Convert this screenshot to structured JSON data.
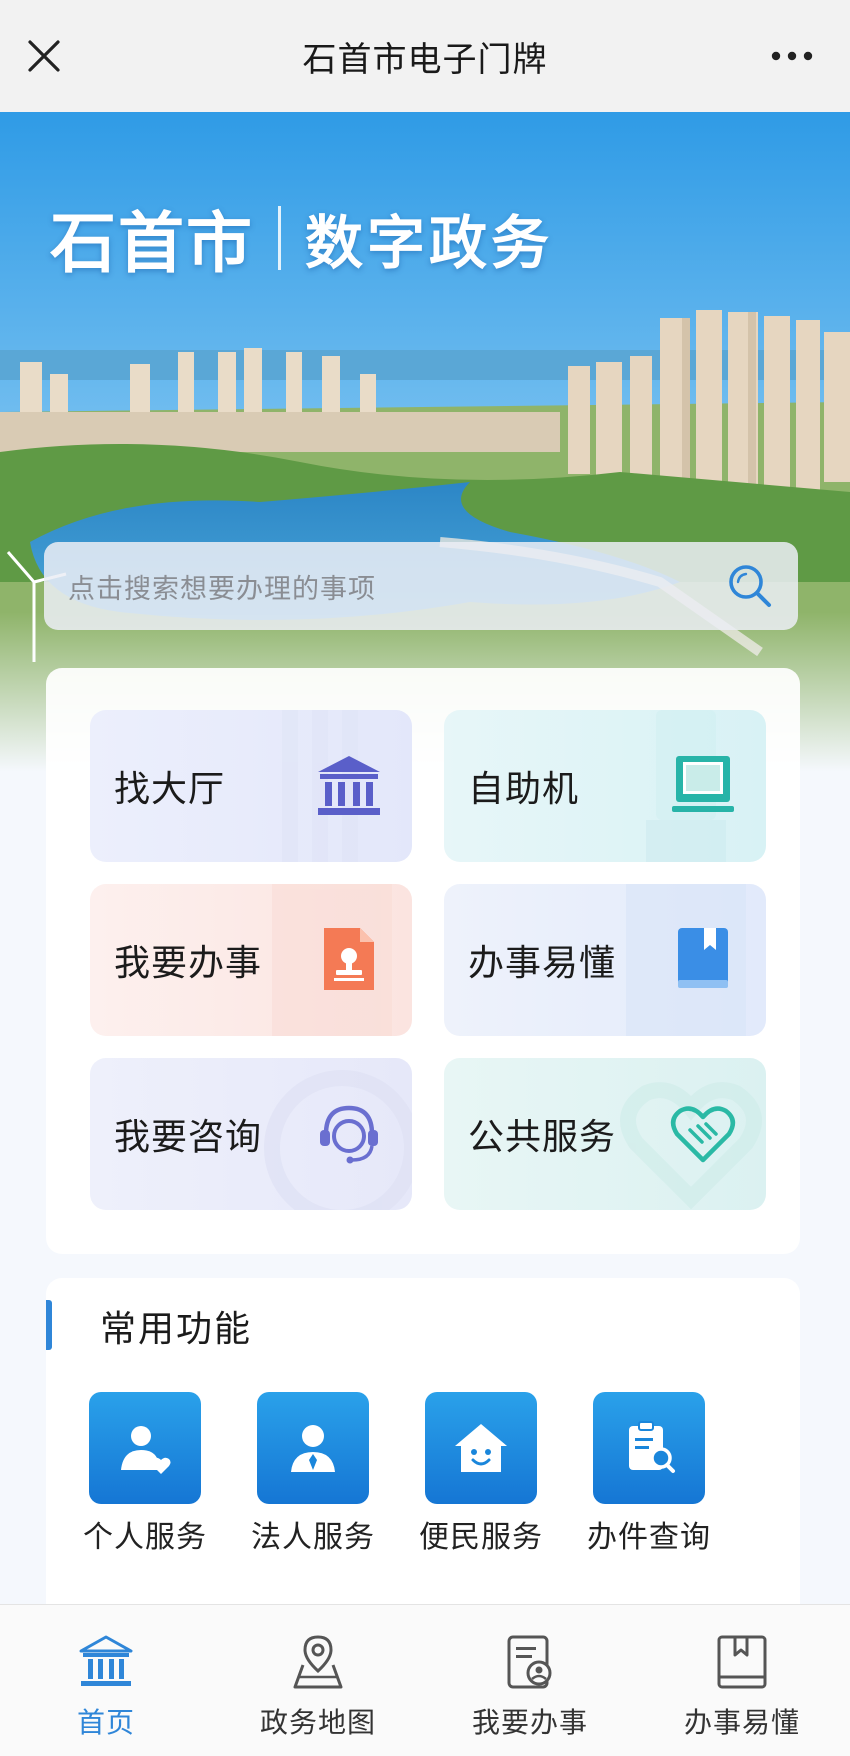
{
  "topbar": {
    "title": "石首市电子门牌",
    "close_icon": "close-icon",
    "more_icon": "more-icon"
  },
  "hero": {
    "city": "石首市",
    "subtitle": "数字政务"
  },
  "search": {
    "placeholder": "点击搜索想要办理的事项",
    "icon": "search-icon"
  },
  "tiles": [
    {
      "label": "找大厅",
      "icon": "government-building-icon",
      "color": "#5a5fc9"
    },
    {
      "label": "自助机",
      "icon": "self-service-terminal-icon",
      "color": "#28b4a8"
    },
    {
      "label": "我要办事",
      "icon": "document-stamp-icon",
      "color": "#f47a55"
    },
    {
      "label": "办事易懂",
      "icon": "book-icon",
      "color": "#3a8ee6"
    },
    {
      "label": "我要咨询",
      "icon": "headset-support-icon",
      "color": "#6a6fd0"
    },
    {
      "label": "公共服务",
      "icon": "heart-handshake-icon",
      "color": "#2ab9a5"
    }
  ],
  "common": {
    "title": "常用功能",
    "items": [
      {
        "label": "个人服务",
        "icon": "personal-service-icon"
      },
      {
        "label": "法人服务",
        "icon": "legal-person-service-icon"
      },
      {
        "label": "便民服务",
        "icon": "community-service-icon"
      },
      {
        "label": "办件查询",
        "icon": "case-query-icon"
      }
    ]
  },
  "bottom_nav": {
    "active_color": "#2f86d8",
    "items": [
      {
        "label": "首页",
        "icon": "home-building-icon",
        "active": true
      },
      {
        "label": "政务地图",
        "icon": "map-pin-icon",
        "active": false
      },
      {
        "label": "我要办事",
        "icon": "apply-document-icon",
        "active": false
      },
      {
        "label": "办事易懂",
        "icon": "guide-book-icon",
        "active": false
      }
    ]
  }
}
